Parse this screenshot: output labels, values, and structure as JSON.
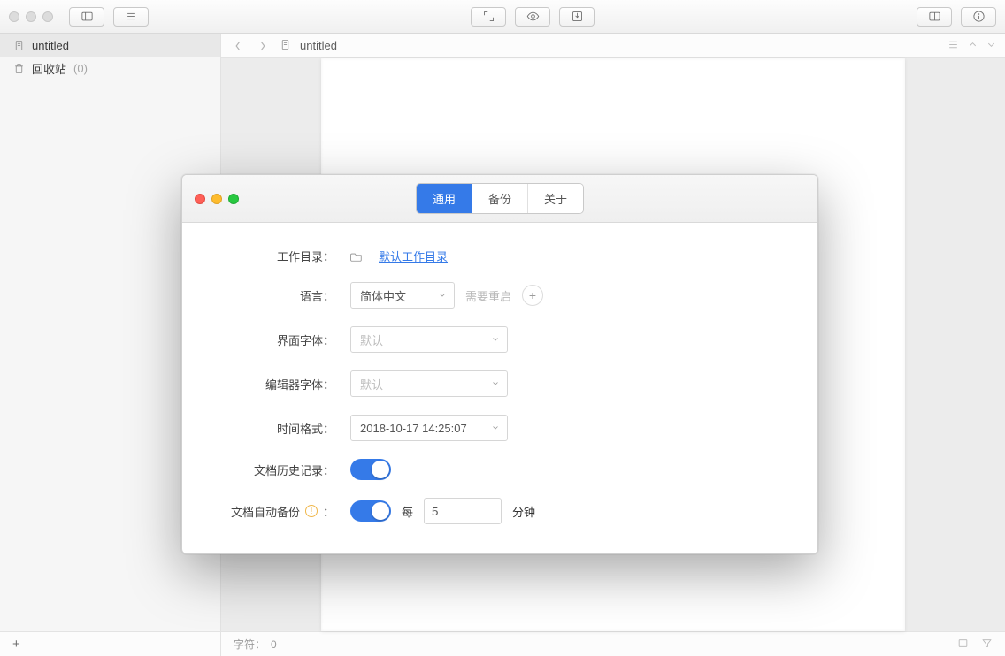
{
  "sidebar": {
    "items": [
      {
        "icon": "doc",
        "label": "untitled"
      },
      {
        "icon": "trash",
        "label": "回收站",
        "count": "(0)"
      }
    ]
  },
  "editor": {
    "crumb": "untitled"
  },
  "status": {
    "chars_label": "字符：",
    "chars_value": "0"
  },
  "prefs": {
    "tabs": {
      "general": "通用",
      "backup": "备份",
      "about": "关于"
    },
    "rows": {
      "workdir": {
        "label": "工作目录：",
        "link": "默认工作目录"
      },
      "language": {
        "label": "语言：",
        "value": "简体中文",
        "hint": "需要重启"
      },
      "ui_font": {
        "label": "界面字体：",
        "placeholder": "默认"
      },
      "editor_font": {
        "label": "编辑器字体：",
        "placeholder": "默认"
      },
      "time_format": {
        "label": "时间格式：",
        "value": "2018-10-17 14:25:07"
      },
      "history": {
        "label": "文档历史记录："
      },
      "auto_backup": {
        "label": "文档自动备份",
        "every": "每",
        "minutes": "分钟",
        "value": "5"
      }
    }
  }
}
